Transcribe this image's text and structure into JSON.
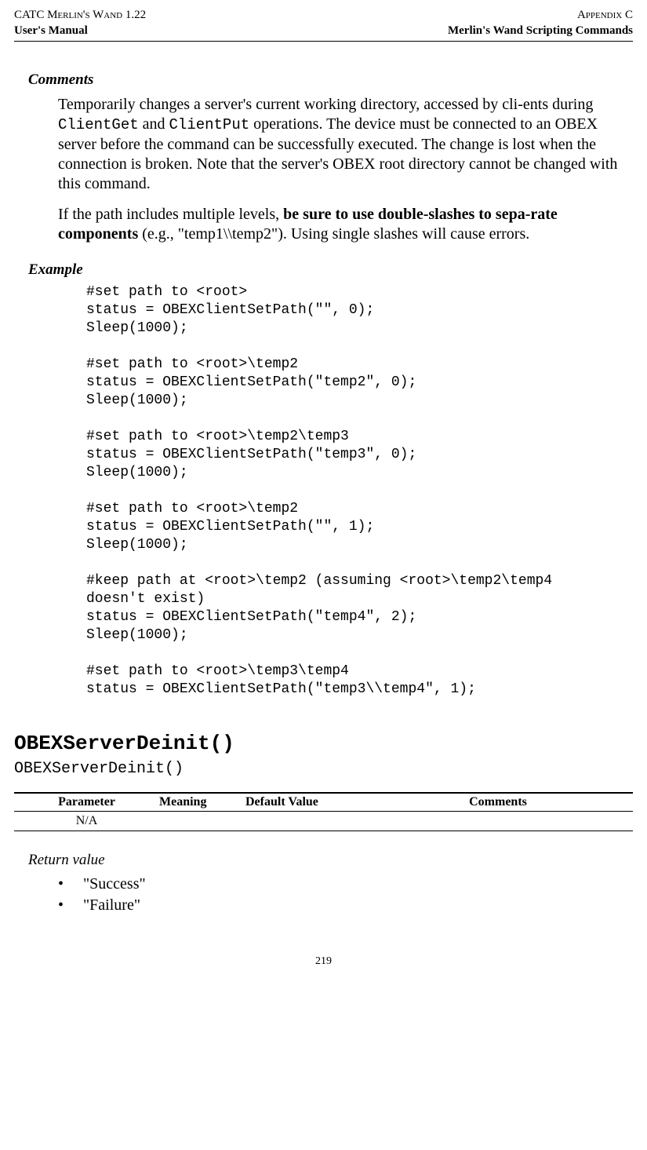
{
  "header": {
    "left_top": "CATC Merlin's Wand 1.22",
    "right_top": "Appendix C",
    "left_bottom": "User's Manual",
    "right_bottom": "Merlin's Wand Scripting Commands"
  },
  "comments": {
    "label": "Comments",
    "p1_a": "Temporarily changes a server's current working directory, accessed by cli-ents during ",
    "p1_code1": "ClientGet",
    "p1_b": " and ",
    "p1_code2": "ClientPut",
    "p1_c": " operations. The device must be connected to an OBEX server before the command can be successfully executed. The change is lost when the connection is broken. Note that the server's OBEX root directory cannot be changed with this command.",
    "p2_a": "If the path includes multiple levels, ",
    "p2_bold": "be sure to use double-slashes to sepa-rate components",
    "p2_b": " (e.g., \"temp1\\\\temp2\"). Using single slashes will cause errors."
  },
  "example": {
    "label": "Example",
    "code": "#set path to <root>\nstatus = OBEXClientSetPath(\"\", 0);\nSleep(1000);\n\n#set path to <root>\\temp2\nstatus = OBEXClientSetPath(\"temp2\", 0);\nSleep(1000);\n\n#set path to <root>\\temp2\\temp3\nstatus = OBEXClientSetPath(\"temp3\", 0);\nSleep(1000);\n\n#set path to <root>\\temp2\nstatus = OBEXClientSetPath(\"\", 1);\nSleep(1000);\n\n#keep path at <root>\\temp2 (assuming <root>\\temp2\\temp4\ndoesn't exist)\nstatus = OBEXClientSetPath(\"temp4\", 2);\nSleep(1000);\n\n#set path to <root>\\temp3\\temp4\nstatus = OBEXClientSetPath(\"temp3\\\\temp4\", 1);"
  },
  "func": {
    "heading": "OBEXServerDeinit()",
    "signature": "OBEXServerDeinit()"
  },
  "table": {
    "headers": {
      "parameter": "Parameter",
      "meaning": "Meaning",
      "default": "Default Value",
      "comments": "Comments"
    },
    "rows": [
      {
        "parameter": "N/A",
        "meaning": "",
        "default": "",
        "comments": ""
      }
    ]
  },
  "return": {
    "label": "Return value",
    "items": [
      "\"Success\"",
      "\"Failure\""
    ]
  },
  "page_number": "219"
}
